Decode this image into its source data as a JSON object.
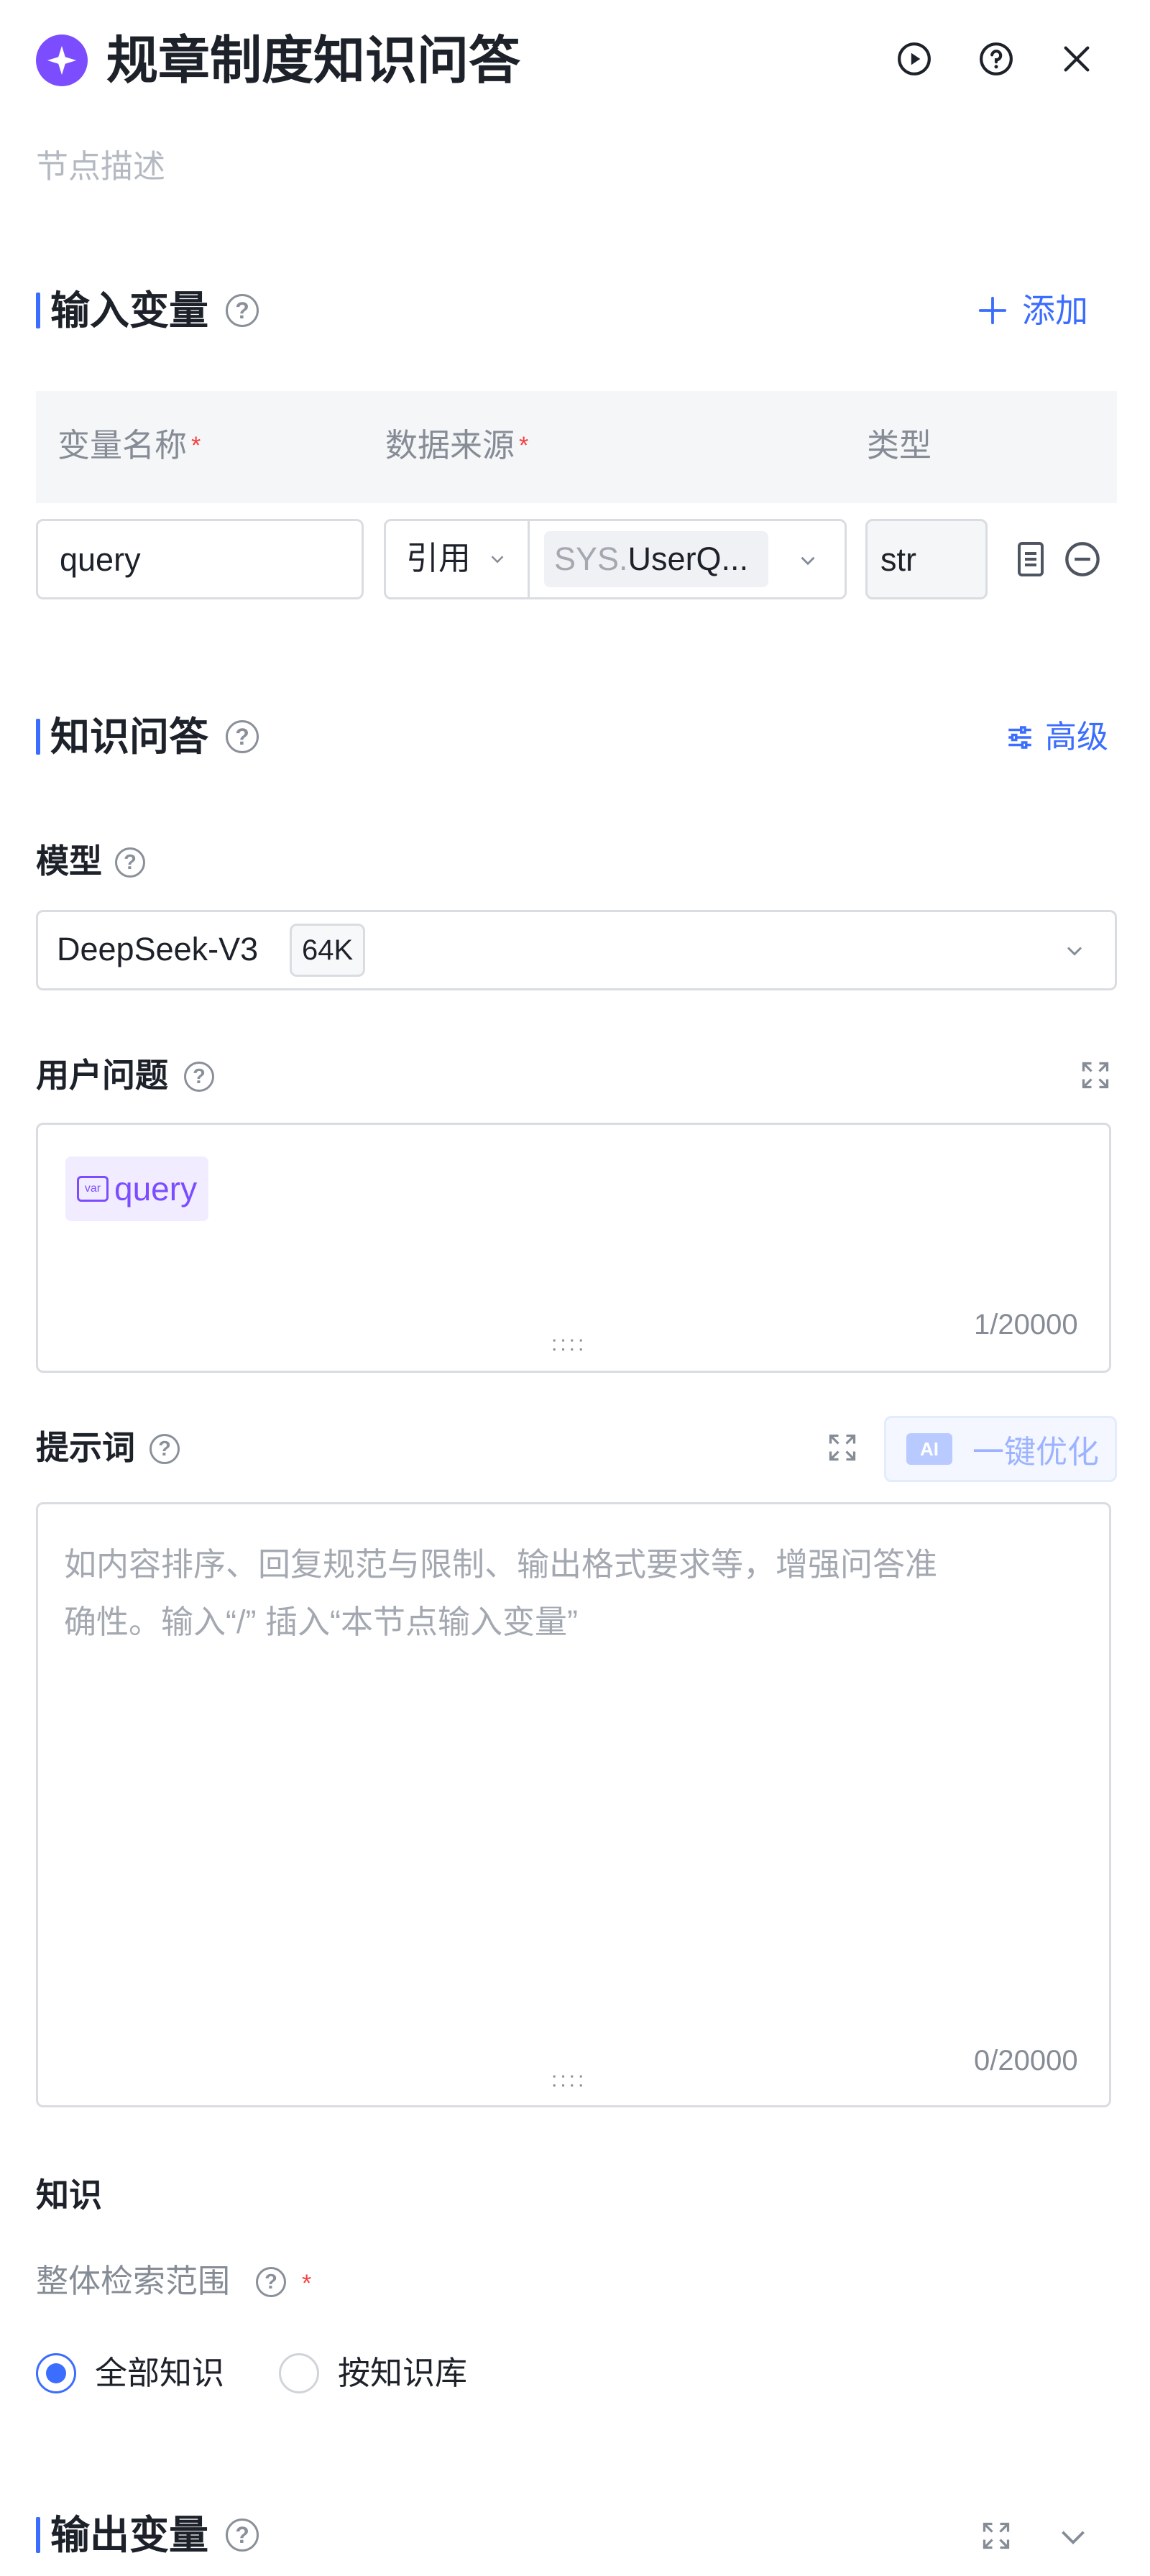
{
  "header": {
    "title": "规章制度知识问答",
    "description_placeholder": "节点描述",
    "icons": [
      "sparkle-icon",
      "run-icon",
      "help-icon",
      "close-icon"
    ]
  },
  "input_section": {
    "title": "输入变量",
    "add_label": "添加",
    "columns": {
      "name": "变量名称",
      "source": "数据来源",
      "type": "类型"
    },
    "required_mark": "*",
    "row": {
      "name": "query",
      "source_mode": "引用",
      "source_prefix": "SYS.",
      "source_value": "UserQ...",
      "type": "str"
    }
  },
  "qa_section": {
    "title": "知识问答",
    "advanced_label": "高级",
    "model": {
      "label": "模型",
      "value": "DeepSeek-V3",
      "badge": "64K"
    },
    "user_question": {
      "label": "用户问题",
      "variable": "query",
      "var_icon_text": "var",
      "counter": "1/20000",
      "grip": "::::"
    },
    "prompt": {
      "label": "提示词",
      "optimize_ai": "AI",
      "optimize_label": "一键优化",
      "placeholder_line1": "如内容排序、回复规范与限制、输出格式要求等，增强问答准",
      "placeholder_line2": "确性。输入“/” 插入“本节点输入变量”",
      "counter": "0/20000",
      "grip": "::::"
    },
    "knowledge": {
      "label": "知识",
      "scope_label": "整体检索范围",
      "required_mark": "*",
      "options": [
        {
          "label": "全部知识",
          "selected": true
        },
        {
          "label": "按知识库",
          "selected": false
        }
      ]
    }
  },
  "output_section": {
    "title": "输出变量"
  },
  "colors": {
    "accent": "#3b6dff",
    "brand": "#7b4dff",
    "required": "#f53f3f",
    "var_chip": "#7b4dff"
  }
}
